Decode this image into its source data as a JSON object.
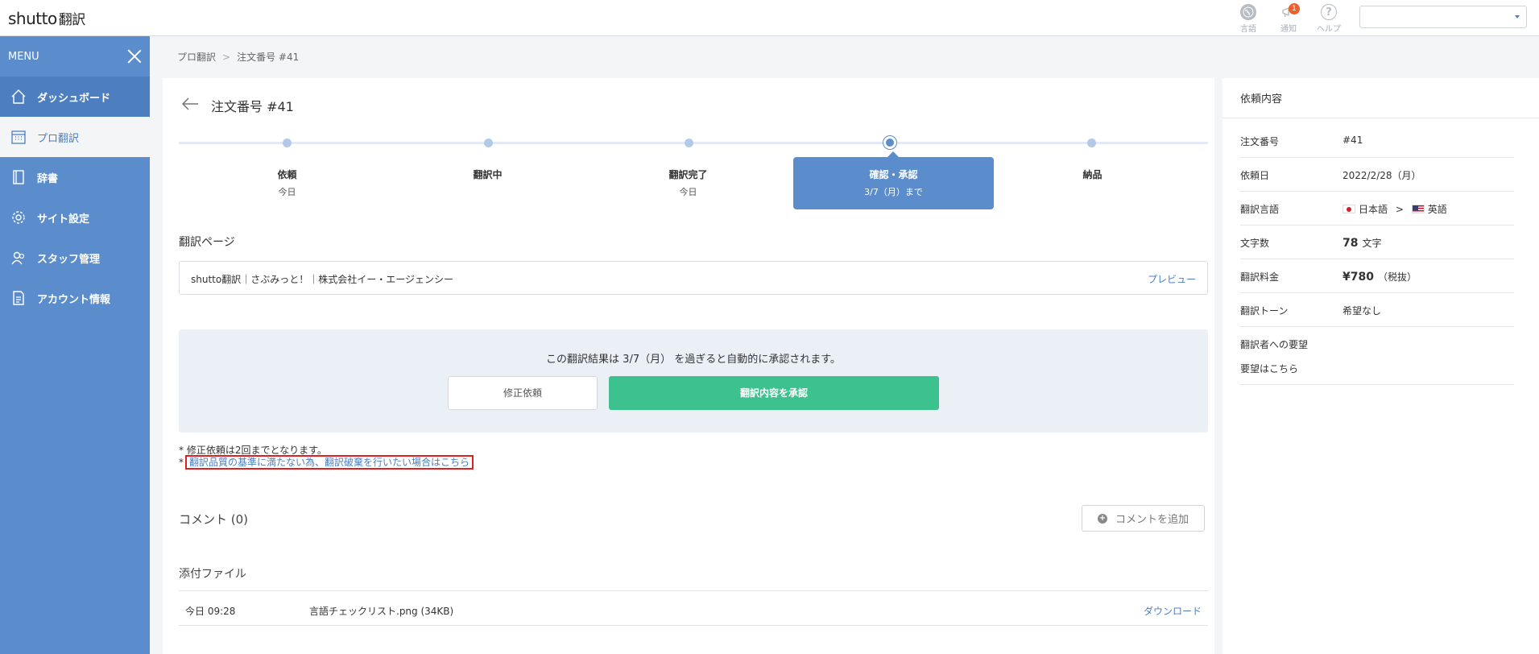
{
  "app": {
    "logo_main": "shutto",
    "logo_sub": "翻訳"
  },
  "topbar": {
    "language_label": "言語",
    "notice_label": "通知",
    "notice_count": "1",
    "help_label": "ヘルプ",
    "help_glyph": "?",
    "select_value": ""
  },
  "sidebar": {
    "menu_label": "MENU",
    "items": [
      {
        "label": "ダッシュボード",
        "icon": "home-icon"
      },
      {
        "label": "プロ翻訳",
        "icon": "calendar-icon"
      },
      {
        "label": "辞書",
        "icon": "book-icon"
      },
      {
        "label": "サイト設定",
        "icon": "gear-icon"
      },
      {
        "label": "スタッフ管理",
        "icon": "staff-icon"
      },
      {
        "label": "アカウント情報",
        "icon": "document-icon"
      }
    ]
  },
  "breadcrumb": {
    "parent": "プロ翻訳",
    "current": "注文番号 #41"
  },
  "order": {
    "title": "注文番号 #41"
  },
  "steps": [
    {
      "name": "依頼",
      "sub": "今日"
    },
    {
      "name": "翻訳中",
      "sub": ""
    },
    {
      "name": "翻訳完了",
      "sub": "今日"
    },
    {
      "name": "確認・承認",
      "sub": "3/7（月）まで"
    },
    {
      "name": "納品",
      "sub": ""
    }
  ],
  "translation_page": {
    "label": "翻訳ページ",
    "text": "shutto翻訳｜さぶみっと！｜株式会社イー・エージェンシー",
    "preview": "プレビュー"
  },
  "approval": {
    "message": "この翻訳結果は 3/7（月） を過ぎると自動的に承認されます。",
    "fix_button": "修正依頼",
    "approve_button": "翻訳内容を承認"
  },
  "notes": {
    "note1": "* 修正依頼は2回までとなります。",
    "note2_prefix": "*",
    "note2_link": "翻訳品質の基準に満たない為、翻訳破棄を行いたい場合はこちら"
  },
  "comments": {
    "title": "コメント (0)",
    "add_button": "コメントを追加"
  },
  "attachments": {
    "title": "添付ファイル",
    "rows": [
      {
        "time": "今日 09:28",
        "file": "言語チェックリスト.png (34KB)",
        "download": "ダウンロード"
      }
    ]
  },
  "details": {
    "title": "依頼内容",
    "order_no_label": "注文番号",
    "order_no": "#41",
    "date_label": "依頼日",
    "date": "2022/2/28（月）",
    "lang_label": "翻訳言語",
    "lang_from": "日本語",
    "lang_sep": ">",
    "lang_to": "英語",
    "chars_label": "文字数",
    "chars_value": "78",
    "chars_unit": "文字",
    "fee_label": "翻訳料金",
    "fee_value": "¥780",
    "fee_note": "（税抜）",
    "tone_label": "翻訳トーン",
    "tone_value": "希望なし",
    "request_label": "翻訳者への要望",
    "request_value": "要望はこちら"
  },
  "colors": {
    "accent": "#5b8ccb",
    "approve": "#3dc28f",
    "link": "#4a7fc1",
    "highlight": "#e02020"
  }
}
